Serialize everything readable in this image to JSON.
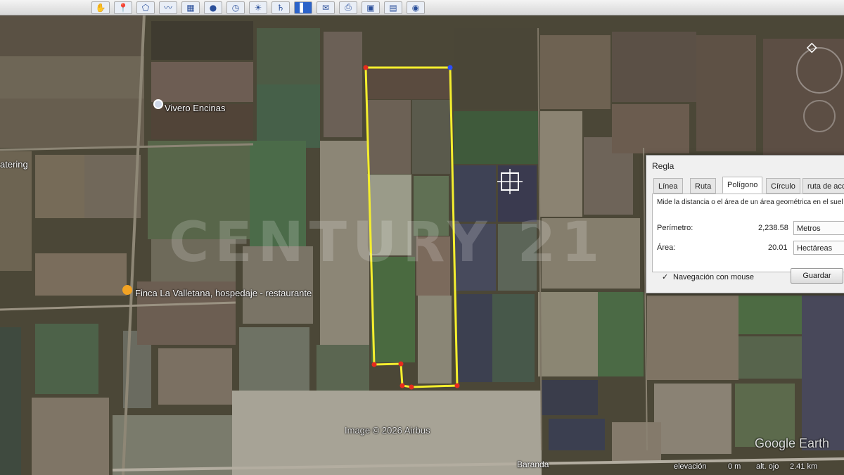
{
  "map": {
    "places": {
      "vivero": "Vivero Encinas",
      "catering": "atering",
      "finca": "Finca La Valletana, hospedaje - restaurante",
      "baranda": "Baranda"
    },
    "imagery_credit": "Image © 2026 Airbus",
    "logo": "Google Earth",
    "status": {
      "coords": "elevación",
      "elev": "0 m",
      "eye_alt": "alt. ojo",
      "eye_val": "2.41 km"
    },
    "watermark": "CENTURY 21",
    "colors": {
      "polygon": "#f4ee2e",
      "vertex": "#e52b1f",
      "vertex_start": "#2b4dff"
    }
  },
  "toolbar": {
    "icons": [
      "hand-icon",
      "placemark-icon",
      "polygon-icon",
      "path-icon",
      "overlay-icon",
      "record-tour-icon",
      "historical-icon",
      "sun-icon",
      "planets-icon",
      "ruler-icon",
      "email-icon",
      "print-icon",
      "save-image-icon",
      "map-icon",
      "globe-icon"
    ]
  },
  "dialog": {
    "title": "Regla",
    "tabs": [
      "Línea",
      "Ruta",
      "Polígono",
      "Círculo",
      "ruta de acc"
    ],
    "active_tab": "Polígono",
    "description": "Mide la distancia o el área de un área geométrica en el suel",
    "perimeter_label": "Perímetro:",
    "perimeter_value": "2,238.58",
    "perimeter_unit": "Metros",
    "area_label": "Área:",
    "area_value": "20.01",
    "area_unit": "Hectáreas",
    "mouse_nav_label": "Navegación con mouse",
    "save_label": "Guardar"
  }
}
